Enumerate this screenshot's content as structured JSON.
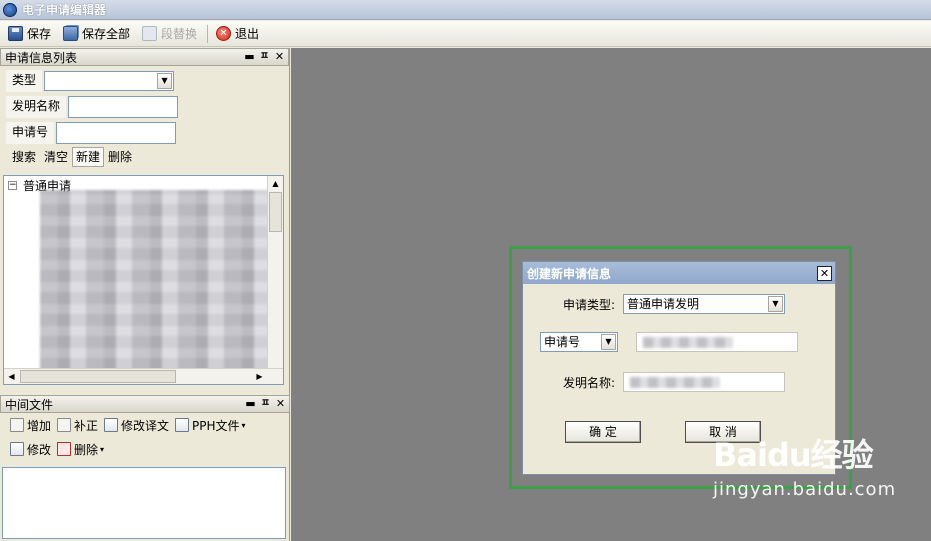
{
  "window": {
    "title": "电子申请编辑器"
  },
  "toolbar": {
    "save": "保存",
    "save_all": "保存全部",
    "replace": "段替换",
    "exit": "退出"
  },
  "list_panel": {
    "title": "申请信息列表",
    "type_label": "类型",
    "type_value": "",
    "invention_name_label": "发明名称",
    "invention_name_value": "",
    "app_no_label": "申请号",
    "app_no_value": "",
    "buttons": [
      "搜索",
      "清空",
      "新建",
      "删除"
    ],
    "tree_root": "普通申请"
  },
  "intermediate_panel": {
    "title": "中间文件",
    "row1": [
      "增加",
      "补正",
      "修改译文",
      "PPH文件"
    ],
    "row2": [
      "修改",
      "删除"
    ]
  },
  "dialog": {
    "title": "创建新申请信息",
    "app_type_label": "申请类型:",
    "app_type_value": "普通申请发明",
    "number_select_value": "申请号",
    "number_value": "",
    "invention_name_label": "发明名称:",
    "invention_name_value": "",
    "ok": "确 定",
    "cancel": "取 消"
  },
  "watermark": {
    "logo": "Baidu经验",
    "url": "jingyan.baidu.com"
  },
  "colors": {
    "workspace": "#808080",
    "dialog_title": "#9ab0d0",
    "highlight": "#3da048"
  }
}
